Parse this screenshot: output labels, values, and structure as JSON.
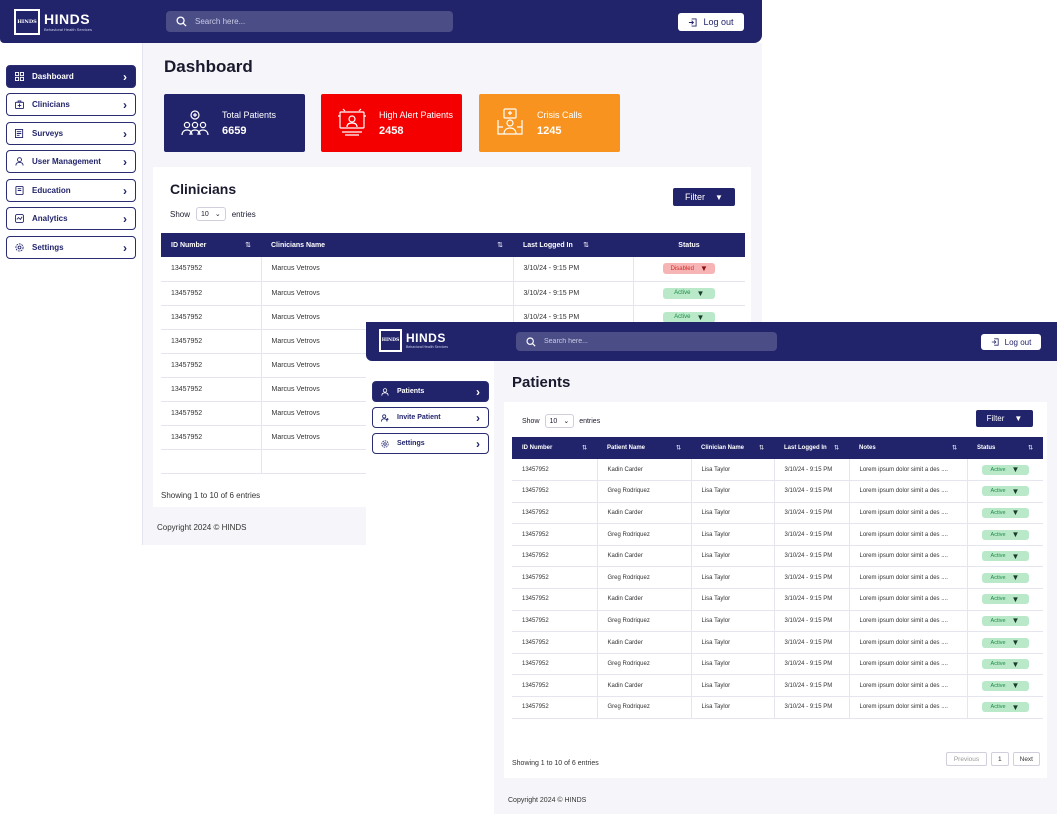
{
  "brand": {
    "name": "HINDS",
    "tagline": "Behavioral Health Services",
    "mark": "HINDS"
  },
  "colors": {
    "primary": "#22246b",
    "danger": "#f50000",
    "warning": "#f7931e",
    "success_bg": "#b9e9c9",
    "danger_bg": "#f7b4b4"
  },
  "header": {
    "search_placeholder": "Search here...",
    "logout_label": "Log out",
    "logout_icon": "logout-icon",
    "search_icon": "search-icon"
  },
  "dashboard": {
    "title": "Dashboard",
    "sidebar": {
      "items": [
        {
          "label": "Dashboard",
          "icon": "dashboard-icon",
          "active": true
        },
        {
          "label": "Clinicians",
          "icon": "clinician-icon",
          "active": false
        },
        {
          "label": "Surveys",
          "icon": "survey-icon",
          "active": false
        },
        {
          "label": "User Management",
          "icon": "user-icon",
          "active": false
        },
        {
          "label": "Education",
          "icon": "education-icon",
          "active": false
        },
        {
          "label": "Analytics",
          "icon": "analytics-icon",
          "active": false
        },
        {
          "label": "Settings",
          "icon": "settings-icon",
          "active": false
        }
      ]
    },
    "stats": [
      {
        "label": "Total Patients",
        "value": "6659",
        "color": "#22246b",
        "icon": "patients-group-icon"
      },
      {
        "label": "High Alert Patients",
        "value": "2458",
        "color": "#f50000",
        "icon": "alert-monitor-icon"
      },
      {
        "label": "Crisis Calls",
        "value": "1245",
        "color": "#f7931e",
        "icon": "crisis-call-icon"
      }
    ],
    "clinicians": {
      "heading": "Clinicians",
      "show_label": "Show",
      "entries_count": "10",
      "entries_label": "entries",
      "filter_label": "Filter",
      "columns": [
        "ID Number",
        "Clinicians Name",
        "Last Logged In",
        "Status"
      ],
      "rows": [
        {
          "id": "13457952",
          "name": "Marcus Vetrovs",
          "last": "3/10/24 - 9:15 PM",
          "status": "Disabled"
        },
        {
          "id": "13457952",
          "name": "Marcus Vetrovs",
          "last": "3/10/24 - 9:15 PM",
          "status": "Active"
        },
        {
          "id": "13457952",
          "name": "Marcus Vetrovs",
          "last": "3/10/24 - 9:15 PM",
          "status": "Active"
        },
        {
          "id": "13457952",
          "name": "Marcus Vetrovs",
          "last": "",
          "status": ""
        },
        {
          "id": "13457952",
          "name": "Marcus Vetrovs",
          "last": "",
          "status": ""
        },
        {
          "id": "13457952",
          "name": "Marcus Vetrovs",
          "last": "",
          "status": ""
        },
        {
          "id": "13457952",
          "name": "Marcus Vetrovs",
          "last": "",
          "status": ""
        },
        {
          "id": "13457952",
          "name": "Marcus Vetrovs",
          "last": "",
          "status": ""
        }
      ],
      "footer": "Showing 1 to 10 of 6 entries"
    },
    "copyright": "Copyright 2024 © HINDS"
  },
  "patients": {
    "title": "Patients",
    "sidebar": {
      "items": [
        {
          "label": "Patients",
          "icon": "patient-icon",
          "active": true
        },
        {
          "label": "Invite Patient",
          "icon": "invite-icon",
          "active": false
        },
        {
          "label": "Settings",
          "icon": "settings-icon",
          "active": false
        }
      ]
    },
    "show_label": "Show",
    "entries_count": "10",
    "entries_label": "entries",
    "filter_label": "Filter",
    "columns": [
      "ID Number",
      "Patient Name",
      "Clinician Name",
      "Last Logged In",
      "Notes",
      "Status"
    ],
    "rows": [
      {
        "id": "13457952",
        "patient": "Kadin Carder",
        "clinician": "Lisa Taylor",
        "last": "3/10/24 - 9:15 PM",
        "notes": "Lorem ipsum dolor simit a des ....",
        "status": "Active"
      },
      {
        "id": "13457952",
        "patient": "Greg Rodriquez",
        "clinician": "Lisa Taylor",
        "last": "3/10/24 - 9:15 PM",
        "notes": "Lorem ipsum dolor simit a des ....",
        "status": "Active"
      },
      {
        "id": "13457952",
        "patient": "Kadin Carder",
        "clinician": "Lisa Taylor",
        "last": "3/10/24 - 9:15 PM",
        "notes": "Lorem ipsum dolor simit a des ....",
        "status": "Active"
      },
      {
        "id": "13457952",
        "patient": "Greg Rodriquez",
        "clinician": "Lisa Taylor",
        "last": "3/10/24 - 9:15 PM",
        "notes": "Lorem ipsum dolor simit a des ....",
        "status": "Active"
      },
      {
        "id": "13457952",
        "patient": "Kadin Carder",
        "clinician": "Lisa Taylor",
        "last": "3/10/24 - 9:15 PM",
        "notes": "Lorem ipsum dolor simit a des ....",
        "status": "Active"
      },
      {
        "id": "13457952",
        "patient": "Greg Rodriquez",
        "clinician": "Lisa Taylor",
        "last": "3/10/24 - 9:15 PM",
        "notes": "Lorem ipsum dolor simit a des ....",
        "status": "Active"
      },
      {
        "id": "13457952",
        "patient": "Kadin Carder",
        "clinician": "Lisa Taylor",
        "last": "3/10/24 - 9:15 PM",
        "notes": "Lorem ipsum dolor simit a des ....",
        "status": "Active"
      },
      {
        "id": "13457952",
        "patient": "Greg Rodriquez",
        "clinician": "Lisa Taylor",
        "last": "3/10/24 - 9:15 PM",
        "notes": "Lorem ipsum dolor simit a des ....",
        "status": "Active"
      },
      {
        "id": "13457952",
        "patient": "Kadin Carder",
        "clinician": "Lisa Taylor",
        "last": "3/10/24 - 9:15 PM",
        "notes": "Lorem ipsum dolor simit a des ....",
        "status": "Active"
      },
      {
        "id": "13457952",
        "patient": "Greg Rodriquez",
        "clinician": "Lisa Taylor",
        "last": "3/10/24 - 9:15 PM",
        "notes": "Lorem ipsum dolor simit a des ....",
        "status": "Active"
      },
      {
        "id": "13457952",
        "patient": "Kadin Carder",
        "clinician": "Lisa Taylor",
        "last": "3/10/24 - 9:15 PM",
        "notes": "Lorem ipsum dolor simit a des ....",
        "status": "Active"
      },
      {
        "id": "13457952",
        "patient": "Greg Rodriquez",
        "clinician": "Lisa Taylor",
        "last": "3/10/24 - 9:15 PM",
        "notes": "Lorem ipsum dolor simit a des ....",
        "status": "Active"
      }
    ],
    "footer": "Showing 1 to 10 of 6 entries",
    "pager": {
      "prev": "Previous",
      "page": "1",
      "next": "Next"
    },
    "copyright": "Copyright 2024 © HINDS"
  }
}
